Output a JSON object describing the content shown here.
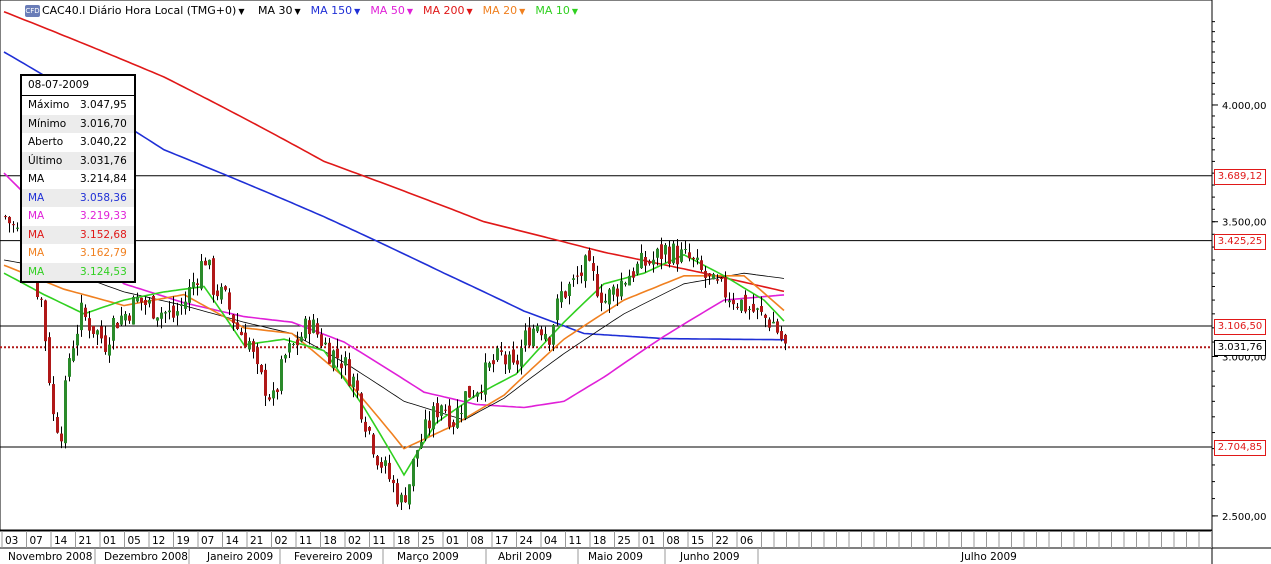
{
  "header": {
    "symbol_label": "CAC40.I Diário Hora Local (TMG+0)",
    "logo_text": "CFD",
    "indicators": [
      {
        "label": "MA 30",
        "color": "#000000"
      },
      {
        "label": "MA 150",
        "color": "#1f2fd6"
      },
      {
        "label": "MA 50",
        "color": "#e020d8"
      },
      {
        "label": "MA 200",
        "color": "#e01818"
      },
      {
        "label": "MA 20",
        "color": "#f08020"
      },
      {
        "label": "MA 10",
        "color": "#30d020"
      }
    ]
  },
  "info_box": {
    "date": "08-07-2009",
    "rows": [
      {
        "key": "Máximo",
        "value": "3.047,95",
        "color": "#000000"
      },
      {
        "key": "Mínimo",
        "value": "3.016,70",
        "color": "#000000"
      },
      {
        "key": "Aberto",
        "value": "3.040,22",
        "color": "#000000"
      },
      {
        "key": "Último",
        "value": "3.031,76",
        "color": "#000000"
      },
      {
        "key": "MA",
        "value": "3.214,84",
        "color": "#000000"
      },
      {
        "key": "MA",
        "value": "3.058,36",
        "color": "#1f2fd6"
      },
      {
        "key": "MA",
        "value": "3.219,33",
        "color": "#e020d8"
      },
      {
        "key": "MA",
        "value": "3.152,68",
        "color": "#e01818"
      },
      {
        "key": "MA",
        "value": "3.162,79",
        "color": "#f08020"
      },
      {
        "key": "MA",
        "value": "3.124,53",
        "color": "#30d020"
      }
    ]
  },
  "chart_data": {
    "type": "candlestick",
    "y_scale": "log",
    "ylim": [
      2460,
      4500
    ],
    "y_ticks": [
      "4.000,00",
      "3.500,00",
      "3.000,00",
      "2.500,00"
    ],
    "y_tick_values": [
      4000,
      3500,
      3000,
      2500
    ],
    "horizontal_lines": [
      {
        "value": 3689.12,
        "label": "3.689,12"
      },
      {
        "value": 3425.25,
        "label": "3.425,25"
      },
      {
        "value": 3106.5,
        "label": "3.106,50"
      },
      {
        "value": 2704.85,
        "label": "2.704,85"
      }
    ],
    "last_price": {
      "value": 3031.76,
      "label": "3.031,76"
    },
    "day_ticks": [
      "03",
      "07",
      "14",
      "21",
      "01",
      "05",
      "12",
      "19",
      "07",
      "14",
      "21",
      "02",
      "11",
      "18",
      "02",
      "11",
      "18",
      "25",
      "01",
      "08",
      "17",
      "24",
      "04",
      "11",
      "18",
      "25",
      "01",
      "08",
      "15",
      "22",
      "06"
    ],
    "months": [
      "Novembro 2008",
      "Dezembro 2008",
      "Janeiro 2009",
      "Fevereiro 2009",
      "Março 2009",
      "Abril 2009",
      "Maio 2009",
      "Junho 2009",
      "Julho 2009"
    ],
    "close_anchors": [
      [
        0,
        3520
      ],
      [
        3,
        3460
      ],
      [
        6,
        3330
      ],
      [
        9,
        3200
      ],
      [
        12,
        2800
      ],
      [
        14,
        2760
      ],
      [
        16,
        3000
      ],
      [
        19,
        3150
      ],
      [
        22,
        3100
      ],
      [
        25,
        3050
      ],
      [
        27,
        3120
      ],
      [
        30,
        3150
      ],
      [
        33,
        3200
      ],
      [
        36,
        3180
      ],
      [
        39,
        3160
      ],
      [
        42,
        3140
      ],
      [
        45,
        3200
      ],
      [
        48,
        3300
      ],
      [
        50,
        3360
      ],
      [
        52,
        3250
      ],
      [
        55,
        3200
      ],
      [
        58,
        3100
      ],
      [
        61,
        3050
      ],
      [
        63,
        2940
      ],
      [
        65,
        2900
      ],
      [
        67,
        2850
      ],
      [
        70,
        3000
      ],
      [
        73,
        3050
      ],
      [
        76,
        3120
      ],
      [
        78,
        3080
      ],
      [
        81,
        3020
      ],
      [
        84,
        2990
      ],
      [
        87,
        2920
      ],
      [
        90,
        2790
      ],
      [
        93,
        2680
      ],
      [
        96,
        2610
      ],
      [
        99,
        2540
      ],
      [
        101,
        2600
      ],
      [
        103,
        2700
      ],
      [
        106,
        2780
      ],
      [
        109,
        2850
      ],
      [
        112,
        2790
      ],
      [
        115,
        2870
      ],
      [
        118,
        2900
      ],
      [
        121,
        2960
      ],
      [
        124,
        3000
      ],
      [
        127,
        2950
      ],
      [
        130,
        3060
      ],
      [
        133,
        3120
      ],
      [
        136,
        3080
      ],
      [
        139,
        3220
      ],
      [
        142,
        3260
      ],
      [
        145,
        3320
      ],
      [
        147,
        3280
      ],
      [
        150,
        3200
      ],
      [
        153,
        3250
      ],
      [
        156,
        3300
      ],
      [
        159,
        3330
      ],
      [
        162,
        3350
      ],
      [
        165,
        3390
      ],
      [
        168,
        3370
      ],
      [
        171,
        3350
      ],
      [
        174,
        3300
      ],
      [
        177,
        3250
      ],
      [
        180,
        3230
      ],
      [
        183,
        3200
      ],
      [
        186,
        3170
      ],
      [
        189,
        3140
      ],
      [
        192,
        3120
      ],
      [
        195,
        3031.76
      ]
    ],
    "ma_anchors": {
      "ma200": [
        [
          0,
          4450
        ],
        [
          40,
          4130
        ],
        [
          80,
          3750
        ],
        [
          120,
          3500
        ],
        [
          150,
          3380
        ],
        [
          175,
          3300
        ],
        [
          195,
          3232
        ]
      ],
      "ma150": [
        [
          0,
          4250
        ],
        [
          40,
          3800
        ],
        [
          80,
          3520
        ],
        [
          110,
          3300
        ],
        [
          130,
          3160
        ],
        [
          145,
          3080
        ],
        [
          165,
          3062
        ],
        [
          195,
          3058
        ]
      ],
      "ma50": [
        [
          0,
          3700
        ],
        [
          15,
          3450
        ],
        [
          30,
          3260
        ],
        [
          45,
          3190
        ],
        [
          60,
          3140
        ],
        [
          72,
          3120
        ],
        [
          85,
          3050
        ],
        [
          105,
          2880
        ],
        [
          118,
          2840
        ],
        [
          130,
          2830
        ],
        [
          140,
          2850
        ],
        [
          150,
          2930
        ],
        [
          165,
          3070
        ],
        [
          180,
          3200
        ],
        [
          195,
          3219
        ]
      ],
      "ma30": [
        [
          0,
          3350
        ],
        [
          15,
          3310
        ],
        [
          30,
          3230
        ],
        [
          45,
          3180
        ],
        [
          60,
          3120
        ],
        [
          72,
          3080
        ],
        [
          85,
          2980
        ],
        [
          100,
          2850
        ],
        [
          115,
          2790
        ],
        [
          125,
          2860
        ],
        [
          140,
          3010
        ],
        [
          155,
          3150
        ],
        [
          170,
          3260
        ],
        [
          185,
          3300
        ],
        [
          195,
          3280
        ]
      ],
      "ma20": [
        [
          0,
          3330
        ],
        [
          15,
          3240
        ],
        [
          30,
          3180
        ],
        [
          45,
          3220
        ],
        [
          60,
          3100
        ],
        [
          72,
          3080
        ],
        [
          85,
          2930
        ],
        [
          100,
          2700
        ],
        [
          112,
          2770
        ],
        [
          125,
          2870
        ],
        [
          140,
          3060
        ],
        [
          155,
          3200
        ],
        [
          170,
          3290
        ],
        [
          185,
          3290
        ],
        [
          195,
          3162
        ]
      ],
      "ma10": [
        [
          0,
          3300
        ],
        [
          10,
          3220
        ],
        [
          20,
          3150
        ],
        [
          30,
          3200
        ],
        [
          40,
          3230
        ],
        [
          50,
          3250
        ],
        [
          60,
          3040
        ],
        [
          70,
          3060
        ],
        [
          80,
          3020
        ],
        [
          90,
          2830
        ],
        [
          100,
          2620
        ],
        [
          108,
          2780
        ],
        [
          118,
          2870
        ],
        [
          128,
          2940
        ],
        [
          140,
          3120
        ],
        [
          150,
          3260
        ],
        [
          160,
          3300
        ],
        [
          170,
          3370
        ],
        [
          180,
          3290
        ],
        [
          190,
          3200
        ],
        [
          195,
          3124
        ]
      ]
    },
    "colors": {
      "ma200": "#e01818",
      "ma150": "#1f2fd6",
      "ma50": "#e020d8",
      "ma30": "#000000",
      "ma20": "#f08020",
      "ma10": "#30d020",
      "candle": "#b01818"
    }
  }
}
